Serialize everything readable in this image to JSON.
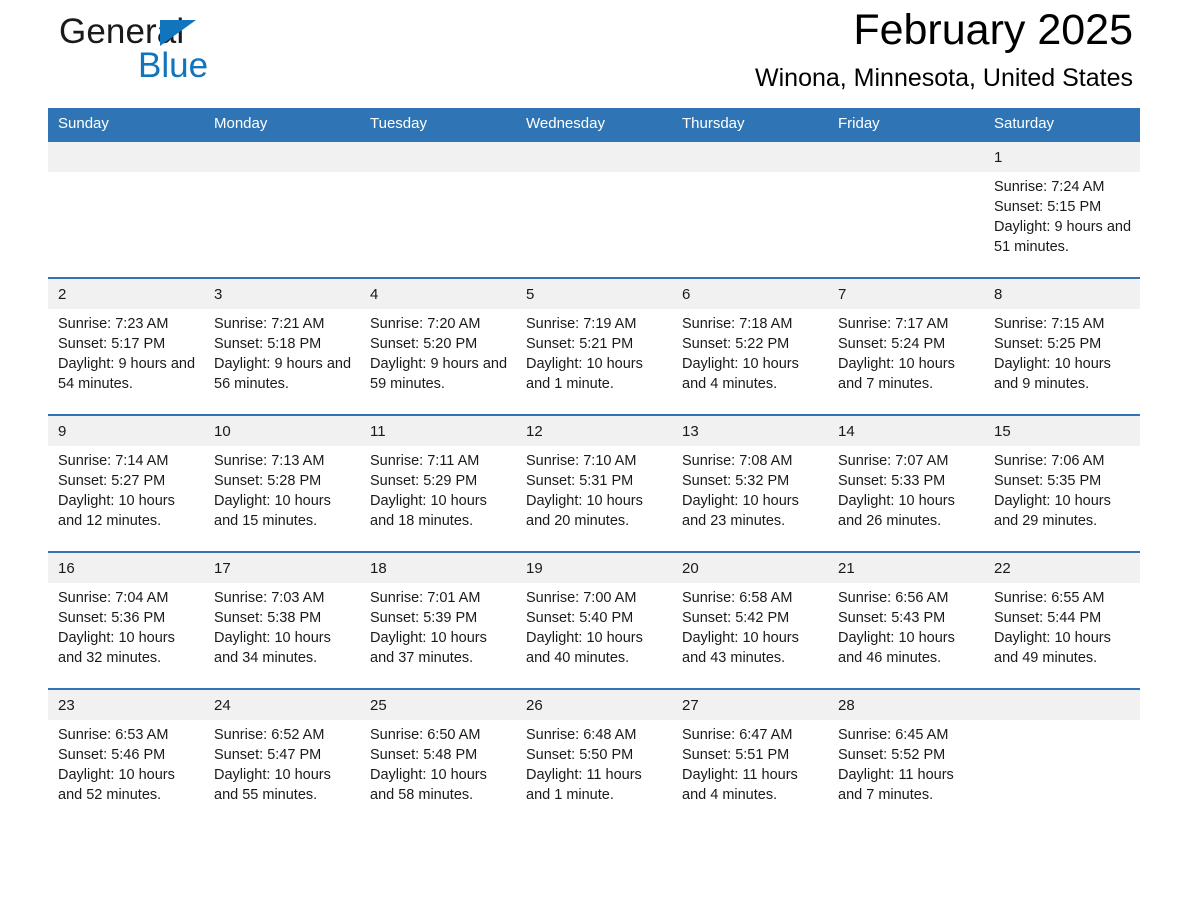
{
  "brand": {
    "name_part1": "General",
    "name_part2": "Blue",
    "triangle_icon": "blue-triangle-icon",
    "accent_color": "#1175bd"
  },
  "header": {
    "title": "February 2025",
    "location": "Winona, Minnesota, United States"
  },
  "theme": {
    "header_blue": "#2f75b5",
    "daynum_band": "#f1f1f1",
    "text": "#1a1a1a"
  },
  "calendar": {
    "weekday_headers": [
      "Sunday",
      "Monday",
      "Tuesday",
      "Wednesday",
      "Thursday",
      "Friday",
      "Saturday"
    ],
    "labels": {
      "sunrise": "Sunrise:",
      "sunset": "Sunset:",
      "daylight": "Daylight:"
    },
    "weeks": [
      [
        {
          "blank": true
        },
        {
          "blank": true
        },
        {
          "blank": true
        },
        {
          "blank": true
        },
        {
          "blank": true
        },
        {
          "blank": true
        },
        {
          "day": "1",
          "sunrise": "Sunrise: 7:24 AM",
          "sunset": "Sunset: 5:15 PM",
          "daylight": "Daylight: 9 hours and 51 minutes."
        }
      ],
      [
        {
          "day": "2",
          "sunrise": "Sunrise: 7:23 AM",
          "sunset": "Sunset: 5:17 PM",
          "daylight": "Daylight: 9 hours and 54 minutes."
        },
        {
          "day": "3",
          "sunrise": "Sunrise: 7:21 AM",
          "sunset": "Sunset: 5:18 PM",
          "daylight": "Daylight: 9 hours and 56 minutes."
        },
        {
          "day": "4",
          "sunrise": "Sunrise: 7:20 AM",
          "sunset": "Sunset: 5:20 PM",
          "daylight": "Daylight: 9 hours and 59 minutes."
        },
        {
          "day": "5",
          "sunrise": "Sunrise: 7:19 AM",
          "sunset": "Sunset: 5:21 PM",
          "daylight": "Daylight: 10 hours and 1 minute."
        },
        {
          "day": "6",
          "sunrise": "Sunrise: 7:18 AM",
          "sunset": "Sunset: 5:22 PM",
          "daylight": "Daylight: 10 hours and 4 minutes."
        },
        {
          "day": "7",
          "sunrise": "Sunrise: 7:17 AM",
          "sunset": "Sunset: 5:24 PM",
          "daylight": "Daylight: 10 hours and 7 minutes."
        },
        {
          "day": "8",
          "sunrise": "Sunrise: 7:15 AM",
          "sunset": "Sunset: 5:25 PM",
          "daylight": "Daylight: 10 hours and 9 minutes."
        }
      ],
      [
        {
          "day": "9",
          "sunrise": "Sunrise: 7:14 AM",
          "sunset": "Sunset: 5:27 PM",
          "daylight": "Daylight: 10 hours and 12 minutes."
        },
        {
          "day": "10",
          "sunrise": "Sunrise: 7:13 AM",
          "sunset": "Sunset: 5:28 PM",
          "daylight": "Daylight: 10 hours and 15 minutes."
        },
        {
          "day": "11",
          "sunrise": "Sunrise: 7:11 AM",
          "sunset": "Sunset: 5:29 PM",
          "daylight": "Daylight: 10 hours and 18 minutes."
        },
        {
          "day": "12",
          "sunrise": "Sunrise: 7:10 AM",
          "sunset": "Sunset: 5:31 PM",
          "daylight": "Daylight: 10 hours and 20 minutes."
        },
        {
          "day": "13",
          "sunrise": "Sunrise: 7:08 AM",
          "sunset": "Sunset: 5:32 PM",
          "daylight": "Daylight: 10 hours and 23 minutes."
        },
        {
          "day": "14",
          "sunrise": "Sunrise: 7:07 AM",
          "sunset": "Sunset: 5:33 PM",
          "daylight": "Daylight: 10 hours and 26 minutes."
        },
        {
          "day": "15",
          "sunrise": "Sunrise: 7:06 AM",
          "sunset": "Sunset: 5:35 PM",
          "daylight": "Daylight: 10 hours and 29 minutes."
        }
      ],
      [
        {
          "day": "16",
          "sunrise": "Sunrise: 7:04 AM",
          "sunset": "Sunset: 5:36 PM",
          "daylight": "Daylight: 10 hours and 32 minutes."
        },
        {
          "day": "17",
          "sunrise": "Sunrise: 7:03 AM",
          "sunset": "Sunset: 5:38 PM",
          "daylight": "Daylight: 10 hours and 34 minutes."
        },
        {
          "day": "18",
          "sunrise": "Sunrise: 7:01 AM",
          "sunset": "Sunset: 5:39 PM",
          "daylight": "Daylight: 10 hours and 37 minutes."
        },
        {
          "day": "19",
          "sunrise": "Sunrise: 7:00 AM",
          "sunset": "Sunset: 5:40 PM",
          "daylight": "Daylight: 10 hours and 40 minutes."
        },
        {
          "day": "20",
          "sunrise": "Sunrise: 6:58 AM",
          "sunset": "Sunset: 5:42 PM",
          "daylight": "Daylight: 10 hours and 43 minutes."
        },
        {
          "day": "21",
          "sunrise": "Sunrise: 6:56 AM",
          "sunset": "Sunset: 5:43 PM",
          "daylight": "Daylight: 10 hours and 46 minutes."
        },
        {
          "day": "22",
          "sunrise": "Sunrise: 6:55 AM",
          "sunset": "Sunset: 5:44 PM",
          "daylight": "Daylight: 10 hours and 49 minutes."
        }
      ],
      [
        {
          "day": "23",
          "sunrise": "Sunrise: 6:53 AM",
          "sunset": "Sunset: 5:46 PM",
          "daylight": "Daylight: 10 hours and 52 minutes."
        },
        {
          "day": "24",
          "sunrise": "Sunrise: 6:52 AM",
          "sunset": "Sunset: 5:47 PM",
          "daylight": "Daylight: 10 hours and 55 minutes."
        },
        {
          "day": "25",
          "sunrise": "Sunrise: 6:50 AM",
          "sunset": "Sunset: 5:48 PM",
          "daylight": "Daylight: 10 hours and 58 minutes."
        },
        {
          "day": "26",
          "sunrise": "Sunrise: 6:48 AM",
          "sunset": "Sunset: 5:50 PM",
          "daylight": "Daylight: 11 hours and 1 minute."
        },
        {
          "day": "27",
          "sunrise": "Sunrise: 6:47 AM",
          "sunset": "Sunset: 5:51 PM",
          "daylight": "Daylight: 11 hours and 4 minutes."
        },
        {
          "day": "28",
          "sunrise": "Sunrise: 6:45 AM",
          "sunset": "Sunset: 5:52 PM",
          "daylight": "Daylight: 11 hours and 7 minutes."
        },
        {
          "blank": true
        }
      ]
    ]
  }
}
